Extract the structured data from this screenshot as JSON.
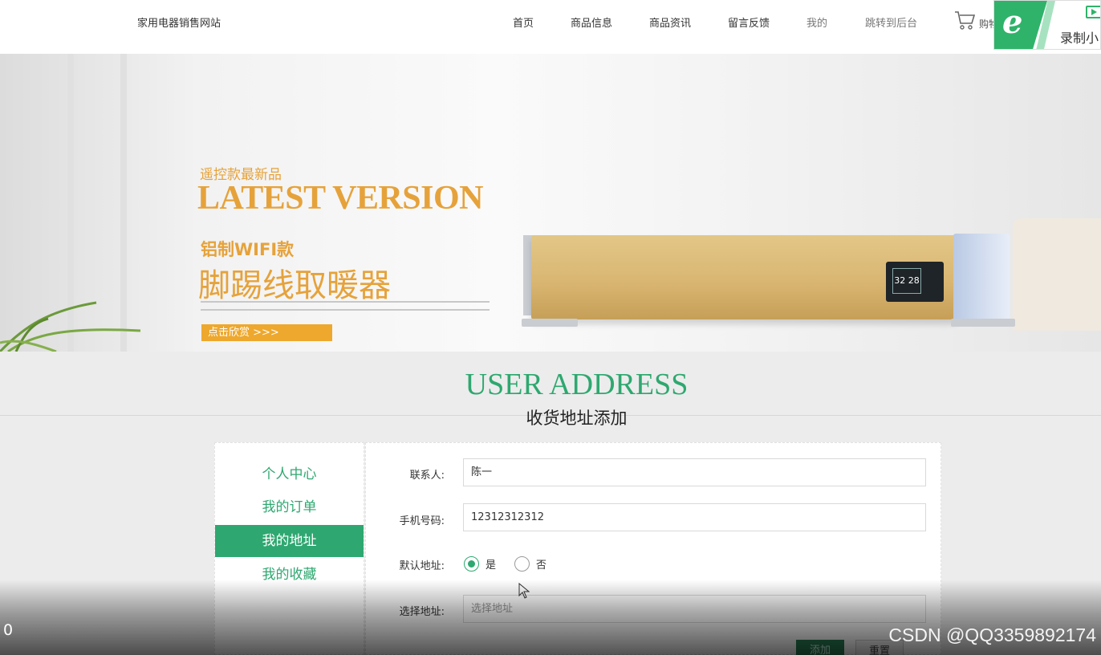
{
  "header": {
    "site_name": "家用电器销售网站",
    "nav": [
      "首页",
      "商品信息",
      "商品资讯",
      "留言反馈",
      "我的",
      "跳转到后台"
    ],
    "cart_label": "购物车"
  },
  "recorder": {
    "label": "录制小"
  },
  "banner": {
    "subtitle": "遥控款最新品",
    "title": "LATEST VERSION",
    "tag": "铝制WIFI款",
    "product": "脚踢线取暖器",
    "button": "点击欣赏 >>>",
    "display_value": "32 28"
  },
  "section": {
    "title_en": "USER ADDRESS",
    "title_cn": "收货地址添加"
  },
  "sidebar": {
    "items": [
      "个人中心",
      "我的订单",
      "我的地址",
      "我的收藏"
    ],
    "active": "我的地址"
  },
  "form": {
    "contact_label": "联系人:",
    "contact_value": "陈一",
    "phone_label": "手机号码:",
    "phone_value": "12312312312",
    "default_label": "默认地址:",
    "default_yes": "是",
    "default_no": "否",
    "default_selected": "是",
    "address_label": "选择地址:",
    "address_placeholder": "选择地址",
    "add_button": "添加",
    "reset_button": "重置"
  },
  "overlay": {
    "time": "0",
    "watermark": "CSDN @QQ3359892174"
  },
  "colors": {
    "accent": "#2ea870",
    "banner_gold": "#e6a23a",
    "recorder_green": "#2fb36a"
  }
}
